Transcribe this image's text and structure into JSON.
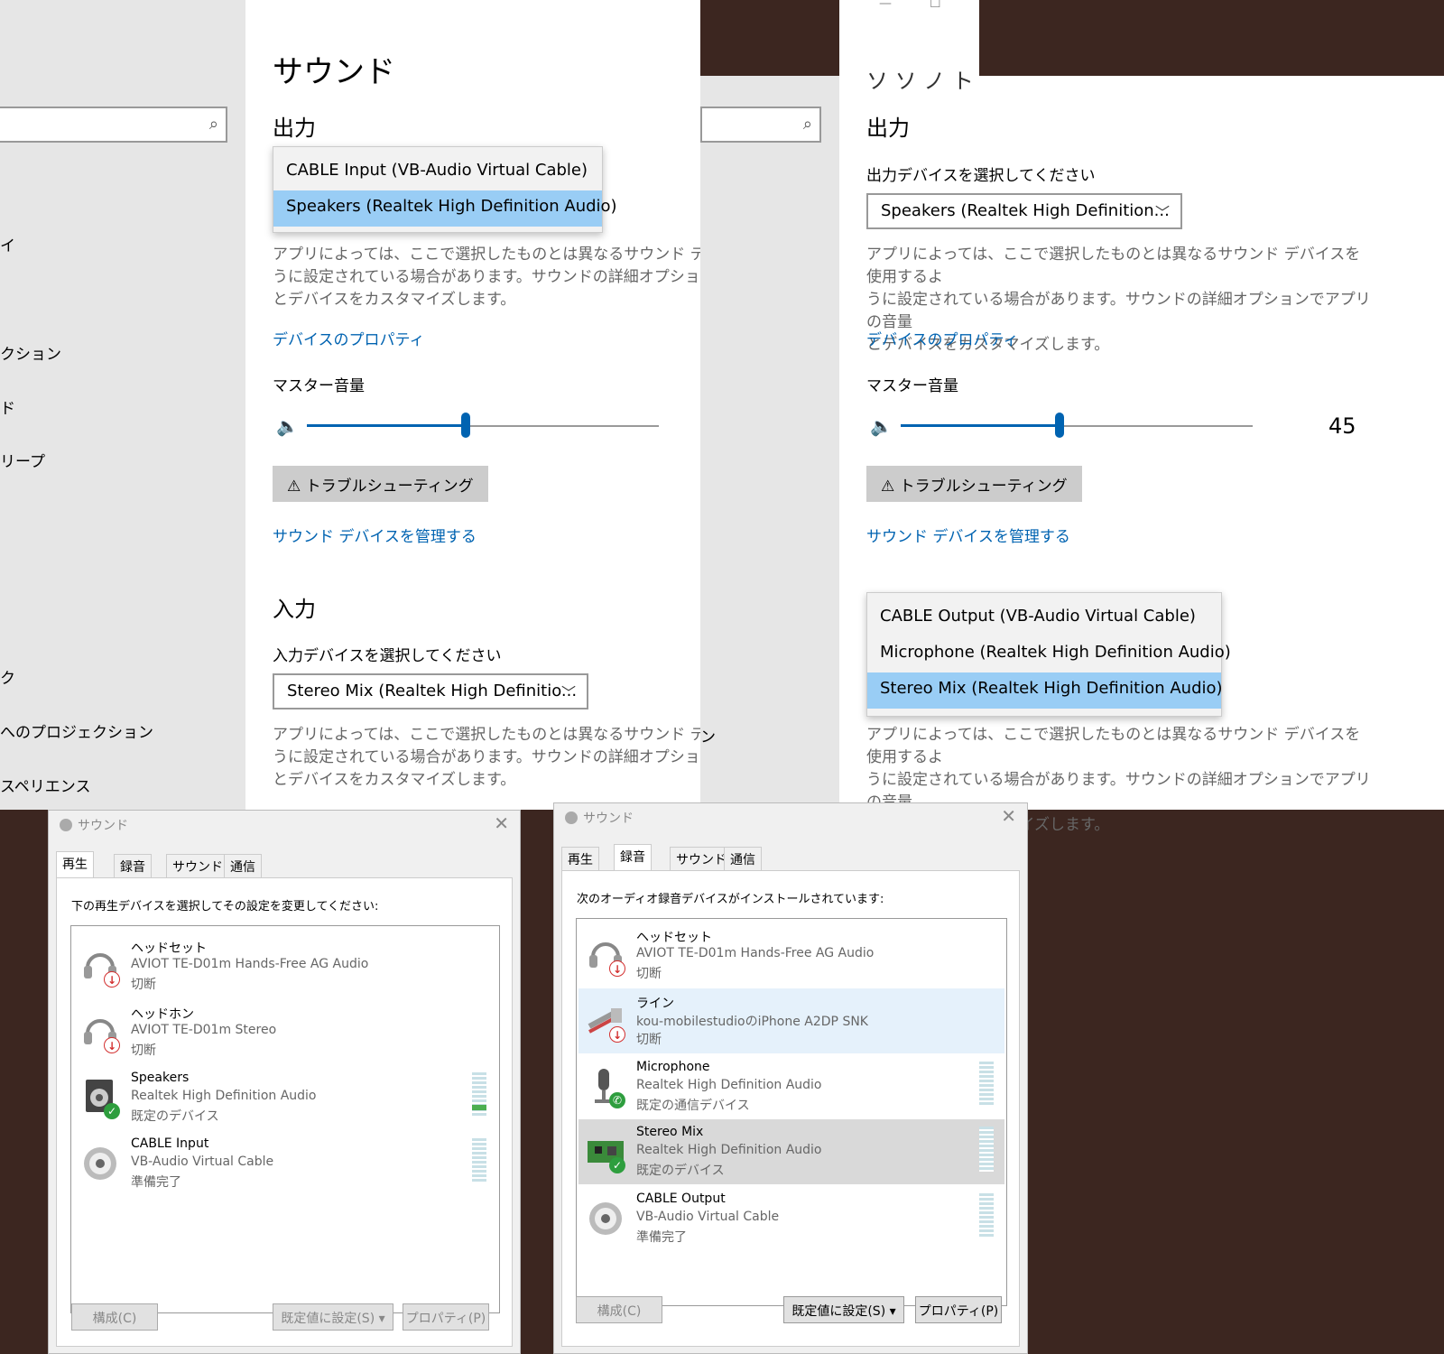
{
  "sidebar": {
    "items": [
      "イ",
      "クション",
      "ド",
      "リープ",
      "ク",
      "へのプロジェクション",
      "スペリエンス"
    ]
  },
  "settings_left": {
    "title": "サウンド",
    "output_heading": "出力",
    "output_dropdown_options": [
      "CABLE Input (VB-Audio Virtual Cable)",
      "Speakers (Realtek High Definition Audio)"
    ],
    "output_desc": [
      "アプリによっては、ここで選択したものとは異なるサウンド デバイスを",
      "うに設定されている場合があります。サウンドの詳細オプションでア",
      "とデバイスをカスタマイズします。"
    ],
    "device_properties_link": "デバイスのプロパティ",
    "master_volume_label": "マスター音量",
    "volume_value": 45,
    "troubleshoot_label": "トラブルシューティング",
    "manage_devices_link": "サウンド デバイスを管理する",
    "input_heading": "入力",
    "input_select_label": "入力デバイスを選択してください",
    "input_select_value": "Stereo Mix (Realtek High Definitio...",
    "input_desc": [
      "アプリによっては、ここで選択したものとは異なるサウンド デバイスを",
      "うに設定されている場合があります。サウンドの詳細オプションでア",
      "とデバイスをカスタマイズします。"
    ],
    "overlap_char": "ン"
  },
  "settings_right": {
    "title_fragment": "ソ ソ ノ ト",
    "output_heading": "出力",
    "output_select_label": "出力デバイスを選択してください",
    "output_select_value": "Speakers (Realtek High Definition...",
    "output_desc": [
      "アプリによっては、ここで選択したものとは異なるサウンド デバイスを使用するよ",
      "うに設定されている場合があります。サウンドの詳細オプションでアプリの音量",
      "とデバイスをカスタマイズします。"
    ],
    "device_properties_link": "デバイスのプロパティ",
    "master_volume_label": "マスター音量",
    "volume_value": 45,
    "volume_display": "45",
    "troubleshoot_label": "トラブルシューティング",
    "manage_devices_link": "サウンド デバイスを管理する",
    "input_dropdown_options": [
      "CABLE Output (VB-Audio Virtual Cable)",
      "Microphone (Realtek High Definition Audio)",
      "Stereo Mix (Realtek High Definition Audio)"
    ],
    "input_desc": [
      "アプリによっては、ここで選択したものとは異なるサウンド デバイスを使用するよ",
      "うに設定されている場合があります。サウンドの詳細オプションでアプリの音量",
      "とデバイスをカスタマイズします。"
    ]
  },
  "dialog_playback": {
    "title": "サウンド",
    "tabs": [
      "再生",
      "録音",
      "サウンド",
      "通信"
    ],
    "active_tab": "再生",
    "instruction": "下の再生デバイスを選択してその設定を変更してください:",
    "devices": [
      {
        "name": "ヘッドセット",
        "sub": "AVIOT TE-D01m Hands-Free AG Audio",
        "status": "切断",
        "icon": "headset-icon",
        "badge": "disconnected"
      },
      {
        "name": "ヘッドホン",
        "sub": "AVIOT TE-D01m Stereo",
        "status": "切断",
        "icon": "headphones-icon",
        "badge": "disconnected"
      },
      {
        "name": "Speakers",
        "sub": "Realtek High Definition Audio",
        "status": "既定のデバイス",
        "icon": "speaker-icon",
        "badge": "default"
      },
      {
        "name": "CABLE Input",
        "sub": "VB-Audio Virtual Cable",
        "status": "準備完了",
        "icon": "cable-icon",
        "badge": "none"
      }
    ],
    "buttons": {
      "configure": "構成(C)",
      "set_default": "既定値に設定(S)",
      "properties": "プロパティ(P)"
    }
  },
  "dialog_recording": {
    "title": "サウンド",
    "tabs": [
      "再生",
      "録音",
      "サウンド",
      "通信"
    ],
    "active_tab": "録音",
    "instruction": "次のオーディオ録音デバイスがインストールされています:",
    "devices": [
      {
        "name": "ヘッドセット",
        "sub": "AVIOT TE-D01m Hands-Free AG Audio",
        "status": "切断",
        "icon": "headset-icon",
        "badge": "disconnected"
      },
      {
        "name": "ライン",
        "sub": "kou-mobilestudioのiPhone A2DP SNK",
        "status": "切断",
        "icon": "line-in-icon",
        "badge": "disconnected"
      },
      {
        "name": "Microphone",
        "sub": "Realtek High Definition Audio",
        "status": "既定の通信デバイス",
        "icon": "microphone-icon",
        "badge": "comm"
      },
      {
        "name": "Stereo Mix",
        "sub": "Realtek High Definition Audio",
        "status": "既定のデバイス",
        "icon": "circuit-board-icon",
        "badge": "default"
      },
      {
        "name": "CABLE Output",
        "sub": "VB-Audio Virtual Cable",
        "status": "準備完了",
        "icon": "cable-icon",
        "badge": "none"
      }
    ],
    "buttons": {
      "configure": "構成(C)",
      "set_default": "既定値に設定(S)",
      "properties": "プロパティ(P)"
    }
  },
  "colors": {
    "accent": "#0063b1",
    "selection": "#99cdf5",
    "background": "#3c2620"
  }
}
